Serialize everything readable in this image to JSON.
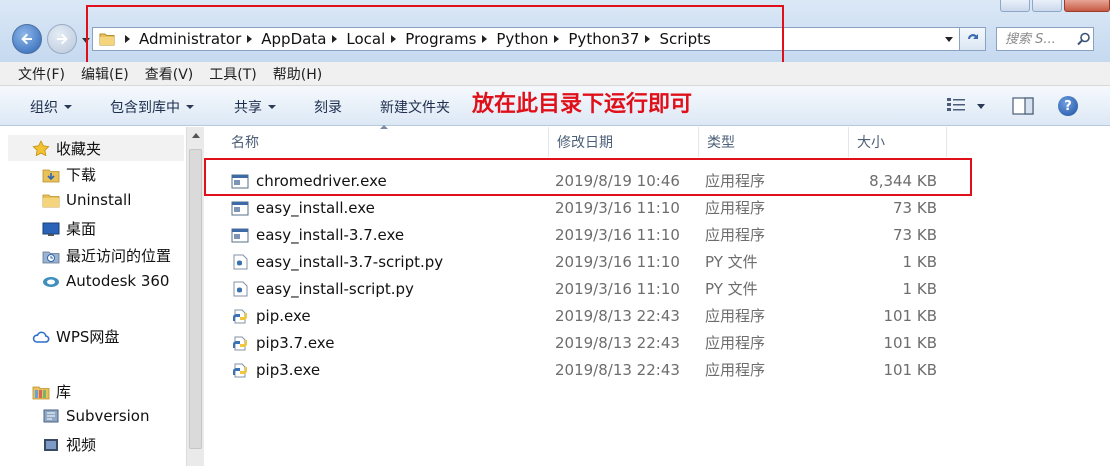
{
  "window": {
    "controls": [
      "minimize",
      "maximize",
      "close"
    ]
  },
  "address": {
    "crumbs": [
      "Administrator",
      "AppData",
      "Local",
      "Programs",
      "Python",
      "Python37",
      "Scripts"
    ]
  },
  "search": {
    "placeholder": "搜索 S..."
  },
  "menu": [
    "文件(F)",
    "编辑(E)",
    "查看(V)",
    "工具(T)",
    "帮助(H)"
  ],
  "toolbar": {
    "organize": "组织",
    "include_in_library": "包含到库中",
    "share": "共享",
    "burn": "刻录",
    "new_folder": "新建文件夹",
    "help": "?"
  },
  "annotation": "放在此目录下运行即可",
  "navigation": {
    "favorites": "收藏夹",
    "items": [
      {
        "label": "下载",
        "icon": "download-folder-icon"
      },
      {
        "label": "Uninstall",
        "icon": "folder-icon"
      },
      {
        "label": "桌面",
        "icon": "desktop-icon"
      },
      {
        "label": "最近访问的位置",
        "icon": "recent-places-icon"
      },
      {
        "label": "Autodesk 360",
        "icon": "autodesk-icon"
      }
    ],
    "wps": "WPS网盘",
    "library": "库",
    "library_items": [
      {
        "label": "Subversion",
        "icon": "subversion-icon"
      },
      {
        "label": "视频",
        "icon": "video-icon"
      }
    ]
  },
  "columns": {
    "name": "名称",
    "date": "修改日期",
    "type": "类型",
    "size": "大小"
  },
  "files": [
    {
      "name": "chromedriver.exe",
      "date": "2019/8/19 10:46",
      "type": "应用程序",
      "size": "8,344 KB",
      "icon": "exe-icon"
    },
    {
      "name": "easy_install.exe",
      "date": "2019/3/16 11:10",
      "type": "应用程序",
      "size": "73 KB",
      "icon": "exe-icon"
    },
    {
      "name": "easy_install-3.7.exe",
      "date": "2019/3/16 11:10",
      "type": "应用程序",
      "size": "73 KB",
      "icon": "exe-icon"
    },
    {
      "name": "easy_install-3.7-script.py",
      "date": "2019/3/16 11:10",
      "type": "PY 文件",
      "size": "1 KB",
      "icon": "python-script-icon"
    },
    {
      "name": "easy_install-script.py",
      "date": "2019/3/16 11:10",
      "type": "PY 文件",
      "size": "1 KB",
      "icon": "python-script-icon"
    },
    {
      "name": "pip.exe",
      "date": "2019/8/13 22:43",
      "type": "应用程序",
      "size": "101 KB",
      "icon": "python-exe-icon"
    },
    {
      "name": "pip3.7.exe",
      "date": "2019/8/13 22:43",
      "type": "应用程序",
      "size": "101 KB",
      "icon": "python-exe-icon"
    },
    {
      "name": "pip3.exe",
      "date": "2019/8/13 22:43",
      "type": "应用程序",
      "size": "101 KB",
      "icon": "python-exe-icon"
    }
  ],
  "colors": {
    "highlight": "#e0101a",
    "toolbar_text": "#1e2f4e",
    "secondary_text": "#6d6d6d"
  }
}
